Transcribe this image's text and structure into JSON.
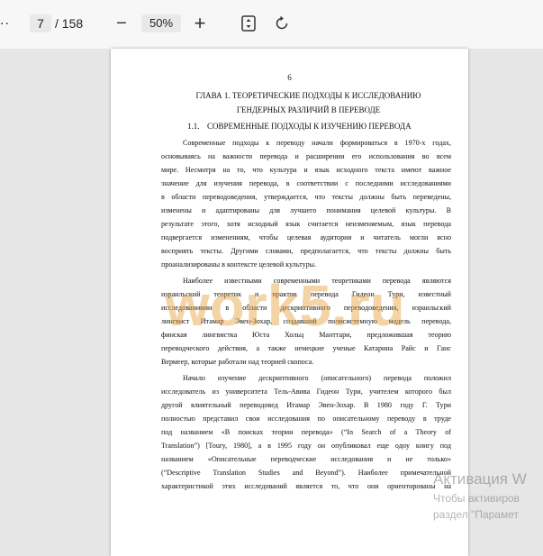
{
  "toolbar": {
    "overflow_glyph": "..",
    "current_page": "7",
    "total_pages": "/ 158",
    "zoom_out_label": "−",
    "zoom_level": "50%",
    "zoom_in_label": "+",
    "fit_icon": "fit-page-icon",
    "rotate_icon": "rotate-icon"
  },
  "document": {
    "page_number": "6",
    "heading_line1": "ГЛАВА 1. ТЕОРЕТИЧЕСКИЕ ПОДХОДЫ К ИССЛЕДОВАНИЮ",
    "heading_line2": "ГЕНДЕРНЫХ РАЗЛИЧИЙ В ПЕРЕВОДЕ",
    "subheading_num": "1.1.",
    "subheading_text": "СОВРЕМЕННЫЕ ПОДХОДЫ К ИЗУЧЕНИЮ ПЕРЕВОДА",
    "lines": [
      "Современные подходы к переводу начали формироваться в 1970-х годах,",
      "основываясь на важности перевода и расширении его использования во всем",
      "мире. Несмотря на то, что культура и язык исходного текста имеют важное",
      "значение для изучения перевода, в соответствии с последними исследованиями",
      "в области переводоведения, утверждается, что тексты должны быть переведены,",
      "изменены и адаптированы для лучшего понимания целевой культуры. В",
      "результате этого, хотя исходный язык считается неизменяемым, язык перевода",
      "подвергается изменениям, чтобы целевая аудитория и читатель могли ясно",
      "восприять тексты. Другими словами, предполагается, что тексты должны быть",
      "проанализированы в контексте целевой культуры.",
      "Наиболее известными современными теоретиками перевода являются",
      "израильский теоретик и практик перевода Гидеон Тури, известный",
      "исследованиями в области дескриптивного переводоведения, израильский",
      "лингвист Итамар Эвен-Зохар, создавший полисистемную модель перевода,",
      "финская лингвистка Юста Хольц Манттари, предложившая теорию",
      "переводческого действия, а также немецкие ученые Катарина Райс и Ганс",
      "Вермеер, которые работали над теорией скопоса.",
      "Начало изучение дескриптивного (описательного) перевода положил",
      "исследователь из университета Тель-Авива Гидеон Тури, учителем которого был",
      "другой влиятельный переводовед Итамар Эвен-Зохар. В 1980 году Г. Тури",
      "полностью представил свои исследования по описательному переводу в труде",
      "под названием «В поисках теории перевода» (“In Search of a Theory of",
      "Translation”) [Toury, 1980], а в 1995 году он опубликовал еще одну книгу под",
      "названием «Описательные переводческие исследования и не только»",
      "(“Descriptive Translation Studies and Beyond”). Наиболее примечательной",
      "характеристикой этих исследований является то, что они ориентированы на"
    ]
  },
  "watermark": {
    "text": "work5.ru"
  },
  "activation": {
    "title": "Активация W",
    "line1": "Чтобы активиров",
    "line2": "раздел \"Парамет"
  }
}
